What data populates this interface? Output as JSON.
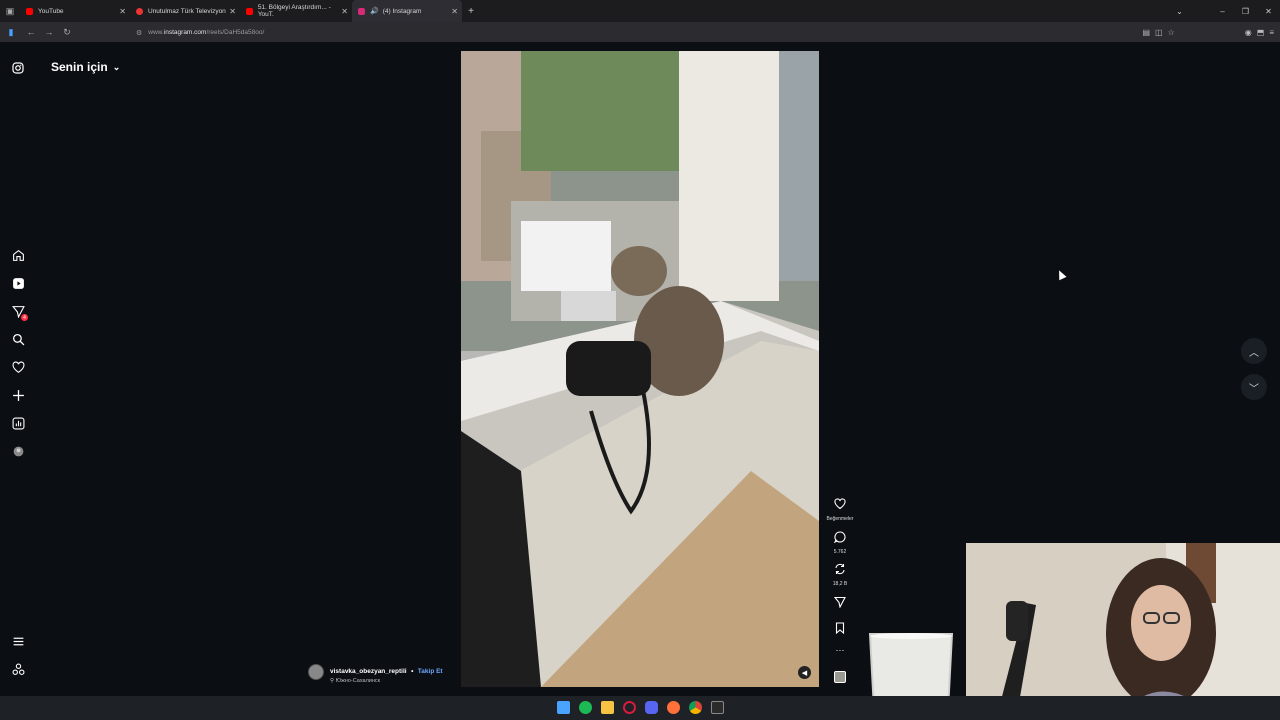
{
  "browser": {
    "tabs": [
      {
        "label": "YouTube",
        "color": "#ff0000",
        "active": false
      },
      {
        "label": "Unutulmaz Türk Televizyon",
        "color": "#e33",
        "active": false
      },
      {
        "label": "51. Bölgeyi Araştırdım... - YouT.",
        "color": "#ff0000",
        "active": false
      },
      {
        "label": "(4) Instagram",
        "color": "#d62976",
        "active": true
      }
    ],
    "url_prefix": "www.",
    "url_host": "instagram.com",
    "url_path": "/reels/DaH5da58oo/"
  },
  "instagram": {
    "header_title": "Senin için",
    "notification_count": "4",
    "author": {
      "username": "vistavka_obezyan_reptili",
      "separator": "•",
      "follow_label": "Takip Et",
      "location": "Южно-Сахалинск"
    },
    "actions": {
      "likes_label": "Beğenmeler",
      "comments_count": "5.762",
      "reposts_count": "18,2 B"
    }
  },
  "icons": {
    "sidebar": [
      "instagram-icon",
      "home-icon",
      "reels-icon",
      "messages-icon",
      "search-icon",
      "notifications-icon",
      "create-icon",
      "dashboard-icon",
      "threads-icon",
      "menu-icon",
      "more-icon"
    ],
    "actions": [
      "heart-icon",
      "comment-icon",
      "repost-icon",
      "share-icon",
      "bookmark-icon",
      "more-icon",
      "audio-icon"
    ]
  },
  "colors": {
    "background": "#0b0f14",
    "accent": "#6ea8ff",
    "badge": "#ff3040"
  }
}
